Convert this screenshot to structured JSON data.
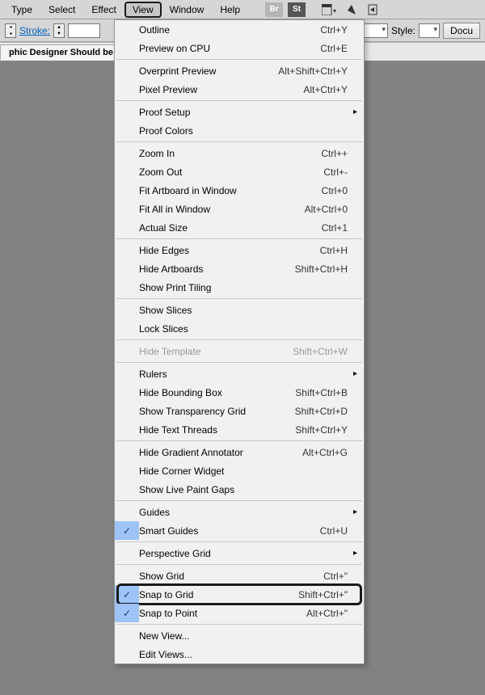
{
  "menubar": {
    "items": [
      "Type",
      "Select",
      "Effect",
      "View",
      "Window",
      "Help"
    ]
  },
  "toolbar": {
    "stroke_label": "Stroke:",
    "style_label": "Style:",
    "docu_label": "Docu"
  },
  "tab": {
    "title": "phic Designer Should be Us"
  },
  "menu": [
    {
      "type": "item",
      "label": "Outline",
      "shortcut": "Ctrl+Y"
    },
    {
      "type": "item",
      "label": "Preview on CPU",
      "shortcut": "Ctrl+E"
    },
    {
      "type": "sep"
    },
    {
      "type": "item",
      "label": "Overprint Preview",
      "shortcut": "Alt+Shift+Ctrl+Y"
    },
    {
      "type": "item",
      "label": "Pixel Preview",
      "shortcut": "Alt+Ctrl+Y"
    },
    {
      "type": "sep"
    },
    {
      "type": "item",
      "label": "Proof Setup",
      "sub": true
    },
    {
      "type": "item",
      "label": "Proof Colors"
    },
    {
      "type": "sep"
    },
    {
      "type": "item",
      "label": "Zoom In",
      "shortcut": "Ctrl++"
    },
    {
      "type": "item",
      "label": "Zoom Out",
      "shortcut": "Ctrl+-"
    },
    {
      "type": "item",
      "label": "Fit Artboard in Window",
      "shortcut": "Ctrl+0"
    },
    {
      "type": "item",
      "label": "Fit All in Window",
      "shortcut": "Alt+Ctrl+0"
    },
    {
      "type": "item",
      "label": "Actual Size",
      "shortcut": "Ctrl+1"
    },
    {
      "type": "sep"
    },
    {
      "type": "item",
      "label": "Hide Edges",
      "shortcut": "Ctrl+H"
    },
    {
      "type": "item",
      "label": "Hide Artboards",
      "shortcut": "Shift+Ctrl+H"
    },
    {
      "type": "item",
      "label": "Show Print Tiling"
    },
    {
      "type": "sep"
    },
    {
      "type": "item",
      "label": "Show Slices"
    },
    {
      "type": "item",
      "label": "Lock Slices"
    },
    {
      "type": "sep"
    },
    {
      "type": "item",
      "label": "Hide Template",
      "shortcut": "Shift+Ctrl+W",
      "disabled": true
    },
    {
      "type": "sep"
    },
    {
      "type": "item",
      "label": "Rulers",
      "sub": true
    },
    {
      "type": "item",
      "label": "Hide Bounding Box",
      "shortcut": "Shift+Ctrl+B"
    },
    {
      "type": "item",
      "label": "Show Transparency Grid",
      "shortcut": "Shift+Ctrl+D"
    },
    {
      "type": "item",
      "label": "Hide Text Threads",
      "shortcut": "Shift+Ctrl+Y"
    },
    {
      "type": "sep"
    },
    {
      "type": "item",
      "label": "Hide Gradient Annotator",
      "shortcut": "Alt+Ctrl+G"
    },
    {
      "type": "item",
      "label": "Hide Corner Widget"
    },
    {
      "type": "item",
      "label": "Show Live Paint Gaps"
    },
    {
      "type": "sep"
    },
    {
      "type": "item",
      "label": "Guides",
      "sub": true
    },
    {
      "type": "item",
      "label": "Smart Guides",
      "shortcut": "Ctrl+U",
      "checked": true
    },
    {
      "type": "sep"
    },
    {
      "type": "item",
      "label": "Perspective Grid",
      "sub": true
    },
    {
      "type": "sep"
    },
    {
      "type": "item",
      "label": "Show Grid",
      "shortcut": "Ctrl+\""
    },
    {
      "type": "item",
      "label": "Snap to Grid",
      "shortcut": "Shift+Ctrl+\"",
      "checked": true,
      "emph": true
    },
    {
      "type": "item",
      "label": "Snap to Point",
      "shortcut": "Alt+Ctrl+\"",
      "checked": true
    },
    {
      "type": "sep"
    },
    {
      "type": "item",
      "label": "New View..."
    },
    {
      "type": "item",
      "label": "Edit Views..."
    }
  ]
}
